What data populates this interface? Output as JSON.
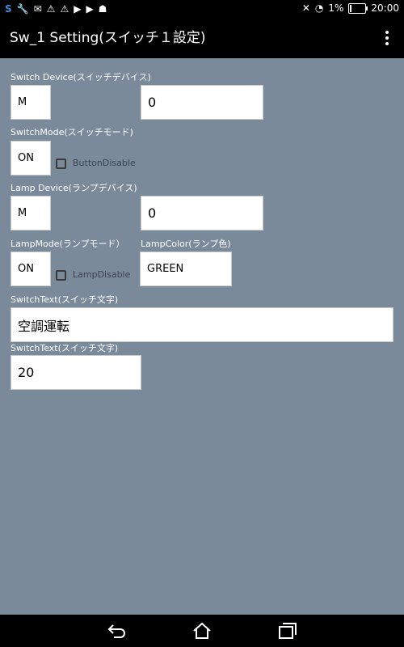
{
  "status_bar": {
    "left_icons": [
      "app-s-icon",
      "wrench-icon",
      "mail-icon",
      "warning-icon",
      "warning-icon",
      "play-store-icon",
      "play-store-icon",
      "android-icon"
    ],
    "battery_percent": "1%",
    "time": "20:00"
  },
  "app_bar": {
    "title": "Sw_1 Setting(スイッチ１設定)"
  },
  "form": {
    "switch_device": {
      "label": "Switch Device(スイッチデバイス)",
      "device_value": "M",
      "number_value": "0"
    },
    "switch_mode": {
      "label": "SwitchMode(スイッチモード)",
      "value": "ON",
      "checkbox_label": "ButtonDisable",
      "checked": false
    },
    "lamp_device": {
      "label": "Lamp Device(ランプデバイス)",
      "device_value": "M",
      "number_value": "0"
    },
    "lamp_mode": {
      "label": "LampMode(ランプモード）",
      "value": "ON",
      "checkbox_label": "LampDisable",
      "checked": false
    },
    "lamp_color": {
      "label": "LampColor(ランプ色)",
      "value": "GREEN"
    },
    "switch_text": {
      "label": "SwitchText(スイッチ文字)",
      "value": "空調運転"
    },
    "switch_text_2": {
      "label": "SwitchText(スイッチ文字)",
      "value": "20"
    }
  },
  "nav_bar": {
    "icons": [
      "back-icon",
      "home-icon",
      "recent-apps-icon"
    ]
  }
}
